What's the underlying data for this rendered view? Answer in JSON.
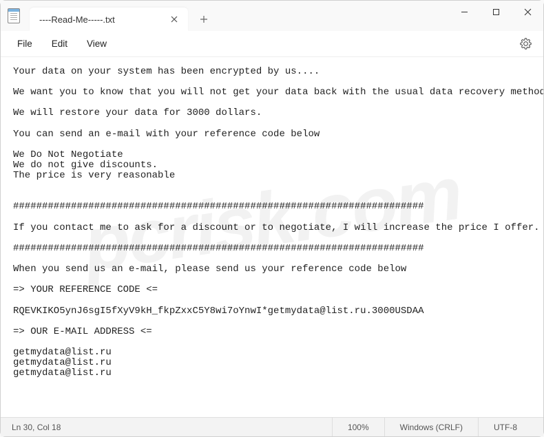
{
  "tab": {
    "title": "----Read-Me-----.txt"
  },
  "menu": {
    "file": "File",
    "edit": "Edit",
    "view": "View"
  },
  "document": {
    "text": "Your data on your system has been encrypted by us....\n\nWe want you to know that you will not get your data back with the usual data recovery methods...\n\nWe will restore your data for 3000 dollars.\n\nYou can send an e-mail with your reference code below\n\nWe Do Not Negotiate\nWe do not give discounts.\nThe price is very reasonable\n\n\n#######################################################################\n\nIf you contact me to ask for a discount or to negotiate, I will increase the price I offer.\n\n#######################################################################\n\nWhen you send us an e-mail, please send us your reference code below\n\n=> YOUR REFERENCE CODE <=\n\nRQEVKIKO5ynJ6sgI5fXyV9kH_fkpZxxC5Y8wi7oYnwI*getmydata@list.ru.3000USDAA\n\n=> OUR E-MAIL ADDRESS <=\n\ngetmydata@list.ru\ngetmydata@list.ru\ngetmydata@list.ru"
  },
  "status": {
    "position": "Ln 30, Col 18",
    "zoom": "100%",
    "line_ending": "Windows (CRLF)",
    "encoding": "UTF-8"
  },
  "watermark": "pcrisk.com"
}
